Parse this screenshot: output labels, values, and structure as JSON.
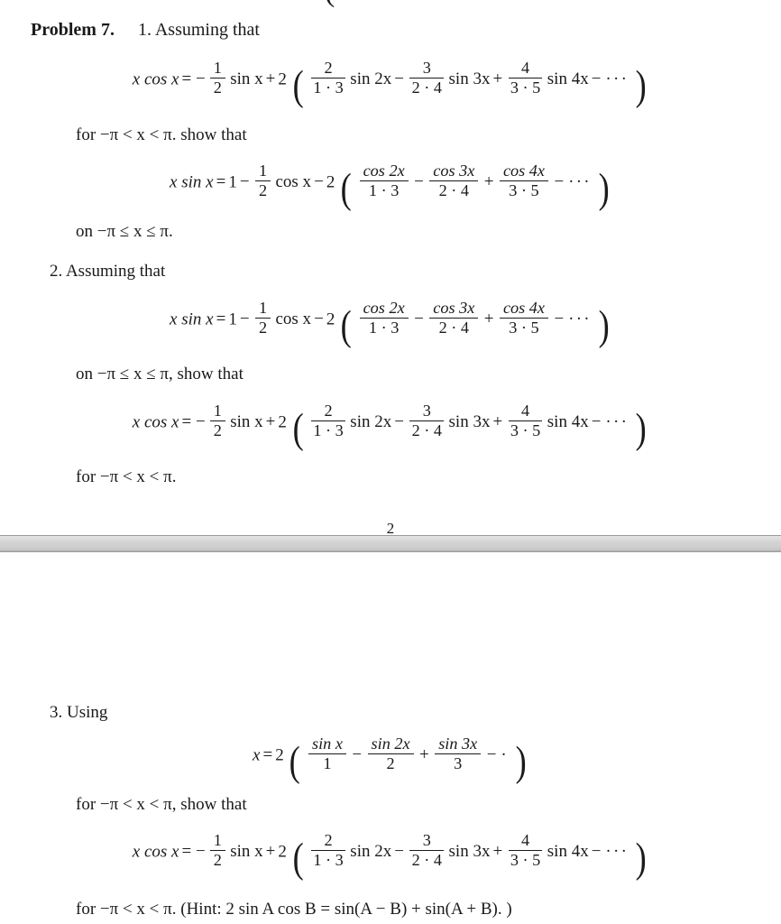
{
  "document": {
    "type": "math-exercise-sheet",
    "page_number_partial": "2",
    "clipped_top_glyph": "(",
    "background_color": "#ffffff",
    "text_color": "#1a1a1a",
    "separator_color": "#d2d2d2"
  },
  "heading": {
    "problem_title": "Problem 7.",
    "first_item_marker": "1.",
    "first_item_text": "Assuming that"
  },
  "items": [
    {
      "marker": "1.",
      "intro": "Assuming that",
      "condition_before": "for −π < x < π. show that",
      "condition_after": "on −π ≤ x ≤ π."
    },
    {
      "marker": "2.",
      "intro": "Assuming that",
      "condition_before": "on −π ≤ x ≤ π, show that",
      "condition_after": "for −π < x < π."
    },
    {
      "marker": "3.",
      "intro": "Using",
      "condition_before": "for −π < x < π, show that",
      "condition_after": "for −π < x < π. (Hint:  2 sin A cos B = sin(A − B) + sin(A + B). )"
    }
  ],
  "equations": {
    "xcos": {
      "lhs": "x cos x",
      "relation": "=",
      "leading_sign": "−",
      "half_num": "1",
      "half_den": "2",
      "first_term": "sin x",
      "plus": "+",
      "factor": "2",
      "terms": [
        {
          "num": "2",
          "den": "1 · 3",
          "fn": "sin 2x",
          "op": ""
        },
        {
          "num": "3",
          "den": "2 · 4",
          "fn": "sin 3x",
          "op": "−"
        },
        {
          "num": "4",
          "den": "3 · 5",
          "fn": "sin 4x",
          "op": "+"
        }
      ],
      "tail_op": "−",
      "tail": "···"
    },
    "xsin": {
      "lhs": "x sin x",
      "relation": "=",
      "one": "1",
      "minus": "−",
      "half_num": "1",
      "half_den": "2",
      "first_term": "cos x",
      "minus2": "−",
      "factor": "2",
      "terms": [
        {
          "num": "cos 2x",
          "den": "1 · 3",
          "op": ""
        },
        {
          "num": "cos 3x",
          "den": "2 · 4",
          "op": "−"
        },
        {
          "num": "cos 4x",
          "den": "3 · 5",
          "op": "+"
        }
      ],
      "tail_op": "−",
      "tail": "···"
    },
    "xseries": {
      "lhs": "x",
      "relation": "=",
      "factor": "2",
      "terms": [
        {
          "num": "sin x",
          "den": "1",
          "op": ""
        },
        {
          "num": "sin 2x",
          "den": "2",
          "op": "−"
        },
        {
          "num": "sin 3x",
          "den": "3",
          "op": "+"
        }
      ],
      "tail_op": "−",
      "tail": "·"
    }
  },
  "symbols": {
    "paren_open": "(",
    "paren_close": ")"
  }
}
